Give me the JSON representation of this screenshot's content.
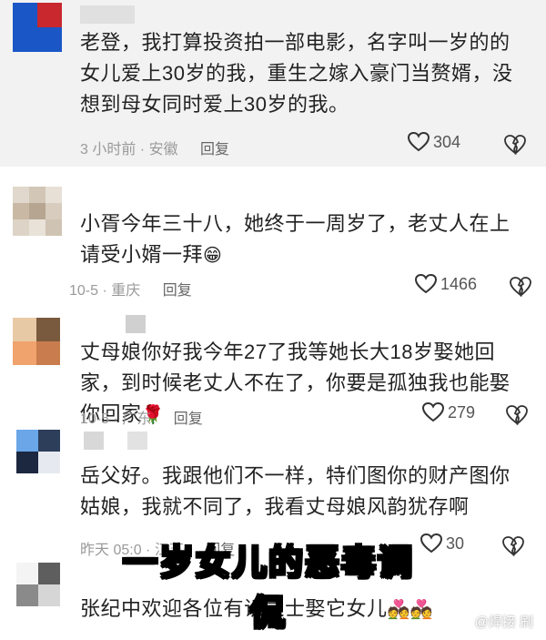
{
  "comments": [
    {
      "text": "老登，我打算投资拍一部电影，名字叫一岁的的女儿爱上30岁的我，重生之嫁入豪门当赘婿，没想到母女同时爱上30岁的我。",
      "time": "3 小时前",
      "location": "安徽",
      "reply_label": "回复",
      "likes": "304"
    },
    {
      "text": "小胥今年三十八，她终于一周岁了，老丈人在上请受小婿一拜",
      "emoji": "😁",
      "time": "10-5",
      "location": "重庆",
      "reply_label": "回复",
      "likes": "1466"
    },
    {
      "text": "丈母娘你好我今年27了我等她长大18岁娶她回家，到时候老丈人不在了，你要是孤独我也能娶你回家",
      "emoji": "🌹",
      "time": "10-5",
      "location": "广东",
      "reply_label": "回复",
      "likes": "279"
    },
    {
      "text": "岳父好。我跟他们不一样，特们图你的财产图你姑娘，我就不同了，我看丈母娘风韵犹存啊",
      "time": "昨天 05:0",
      "location": "江苏",
      "reply_label": "回复",
      "likes": "30"
    },
    {
      "text": "张纪中欢迎各位有识之士娶它女儿",
      "emoji": "💑💑"
    }
  ],
  "overlay_caption": "一岁女儿的恶毒调侃",
  "watermark": "@焊接    刷",
  "colors": {
    "heart": "#333333",
    "text": "#222222",
    "meta": "#9a9a9a"
  }
}
